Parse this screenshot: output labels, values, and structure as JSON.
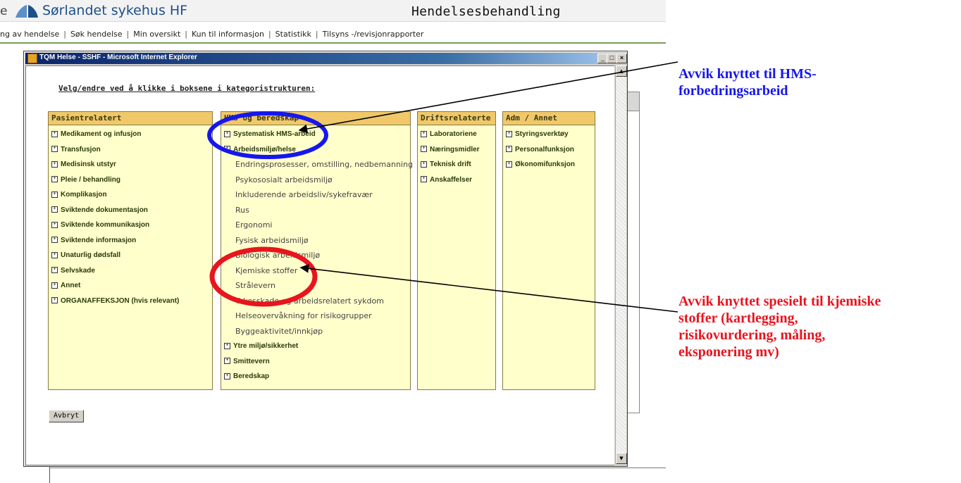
{
  "header": {
    "partial_left_text": "e",
    "org_name": "Sørlandet sykehus HF",
    "app_title": "Hendelsesbehandling"
  },
  "nav": {
    "items": [
      "ng av hendelse",
      "Søk hendelse",
      "Min oversikt",
      "Kun til informasjon",
      "Statistikk",
      "Tilsyns -/revisjonrapporter"
    ],
    "separator": "|"
  },
  "popup": {
    "window_title": "TQM Helse - SSHF - Microsoft Internet Explorer",
    "instruction": "Velg/endre ved å klikke i boksene i kategoristrukturen:",
    "cancel_label": "Avbryt",
    "columns": [
      {
        "header": "Pasientrelatert",
        "items": [
          "Medikament og infusjon",
          "Transfusjon",
          "Medisinsk utstyr",
          "Pleie / behandling",
          "Komplikasjon",
          "Sviktende dokumentasjon",
          "Sviktende kommunikasjon",
          "Sviktende informasjon",
          "Unaturlig dødsfall",
          "Selvskade",
          "Annet",
          "ORGANAFFEKSJON (hvis relevant)"
        ]
      },
      {
        "header": "HMS og beredskap",
        "items": [
          "Systematisk HMS-arbeid",
          "Arbeidsmiljø/helse"
        ],
        "subitems": [
          "Endringsprosesser, omstilling, nedbemanning",
          "Psykososialt arbeidsmiljø",
          "Inkluderende arbeidsliv/sykefravær",
          "Rus",
          "Ergonomi",
          "Fysisk arbeidsmiljø",
          "Biologisk arbeidsmiljø",
          "Kjemiske stoffer",
          "Strålevern",
          "Yrkesskade og arbeidsrelatert sykdom",
          "Helseovervåkning for risikogrupper",
          "Byggeaktivitet/innkjøp"
        ],
        "items_after": [
          "Ytre miljø/sikkerhet",
          "Smittevern",
          "Beredskap"
        ]
      },
      {
        "header": "Driftsrelaterte",
        "items": [
          "Laboratoriene",
          "Næringsmidler",
          "Teknisk drift",
          "Anskaffelser"
        ]
      },
      {
        "header": "Adm / Annet",
        "items": [
          "Styringsverktøy",
          "Personalfunksjon",
          "Økonomifunksjon"
        ]
      }
    ]
  },
  "annotations": {
    "blue_callout": {
      "line1": "Avvik knyttet til HMS-",
      "line2": "forbedringsarbeid",
      "color": "#1616ee"
    },
    "red_callout": {
      "line1": "Avvik knyttet spesielt til kjemiske",
      "line2": "stoffer (kartlegging,",
      "line3": "risikovurdering, måling,",
      "line4": "eksponering mv)",
      "color": "#e8141e"
    }
  }
}
